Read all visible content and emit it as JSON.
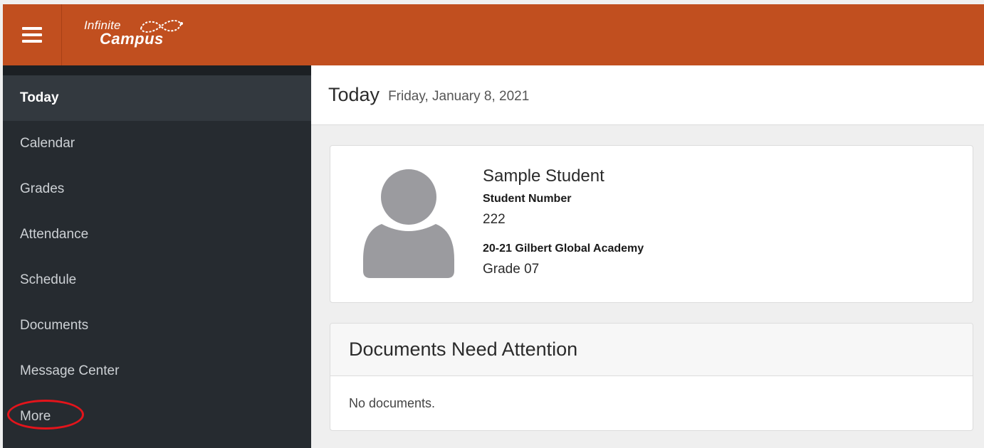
{
  "app": {
    "logo_line1": "Infinite",
    "logo_line2": "Campus",
    "brand_color": "#c14f1f"
  },
  "sidebar": {
    "items": [
      {
        "label": "Today",
        "active": true
      },
      {
        "label": "Calendar",
        "active": false
      },
      {
        "label": "Grades",
        "active": false
      },
      {
        "label": "Attendance",
        "active": false
      },
      {
        "label": "Schedule",
        "active": false
      },
      {
        "label": "Documents",
        "active": false
      },
      {
        "label": "Message Center",
        "active": false
      },
      {
        "label": "More",
        "active": false,
        "highlighted": true
      }
    ],
    "highlight_color": "#e3141b"
  },
  "header": {
    "title": "Today",
    "date": "Friday, January 8, 2021"
  },
  "student": {
    "name": "Sample Student",
    "number_label": "Student Number",
    "number": "222",
    "school": "20-21 Gilbert Global Academy",
    "grade": "Grade 07"
  },
  "documents": {
    "title": "Documents Need Attention",
    "empty_text": "No documents."
  },
  "icons": {
    "menu": "hamburger-menu-icon",
    "avatar": "user-avatar-icon",
    "logo": "infinity-swoosh-icon"
  }
}
